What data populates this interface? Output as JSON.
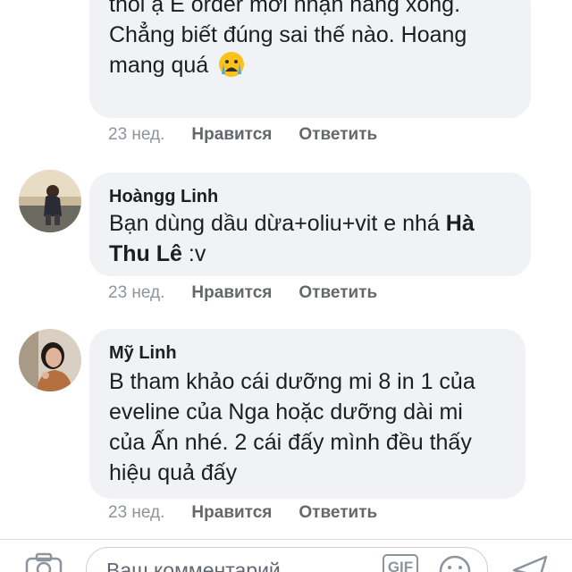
{
  "comments": [
    {
      "author": "",
      "lines": [
        "thôi ạ E order mới nhận hàng xong.",
        "Chẳng biết đúng sai thế nào. Hoang",
        "mang quá"
      ],
      "emoji": "crying-face",
      "time": "23 нед.",
      "like_label": "Нравится",
      "reply_label": "Ответить"
    },
    {
      "author": "Hoàngg Linh",
      "line1": "Bạn dùng dầu dừa+oliu+vit e nhá",
      "mention_part1": "Hà",
      "mention_part2": "Thu Lê",
      "line2_tail": " :v",
      "time": "23 нед.",
      "like_label": "Нравится",
      "reply_label": "Ответить"
    },
    {
      "author": "Mỹ Linh",
      "lines": [
        "B tham khảo cái dưỡng mi 8 in 1 của",
        "eveline của Nga hoặc dưỡng dài mi",
        "của Ấn nhé. 2 cái đấy mình đều thấy",
        "hiệu quả đấy"
      ],
      "time": "23 нед.",
      "like_label": "Нравится",
      "reply_label": "Ответить"
    }
  ],
  "composer": {
    "placeholder": "Ваш комментарий",
    "gif_label": "GIF"
  },
  "colors": {
    "bubble": "#f0f2f5",
    "meta": "#8d949e",
    "text": "#1c1e21"
  }
}
